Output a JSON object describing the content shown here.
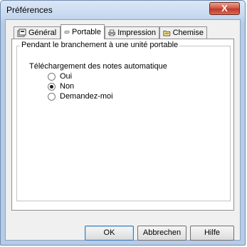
{
  "window": {
    "title": "Préférences",
    "close_label": "X"
  },
  "tabs": [
    {
      "label": "Général",
      "icon": "settings-icon"
    },
    {
      "label": "Portable",
      "icon": "portable-icon"
    },
    {
      "label": "Impression",
      "icon": "printer-icon"
    },
    {
      "label": "Chemise",
      "icon": "folder-icon"
    }
  ],
  "active_tab": "Portable",
  "group": {
    "title": "Pendant le branchement à une unité portable",
    "setting_label": "Téléchargement des notes automatique",
    "options": [
      "Oui",
      "Non",
      "Demandez-moi"
    ],
    "selected": "Non"
  },
  "buttons": {
    "ok": "OK",
    "cancel": "Abbrechen",
    "help": "Hilfe"
  }
}
